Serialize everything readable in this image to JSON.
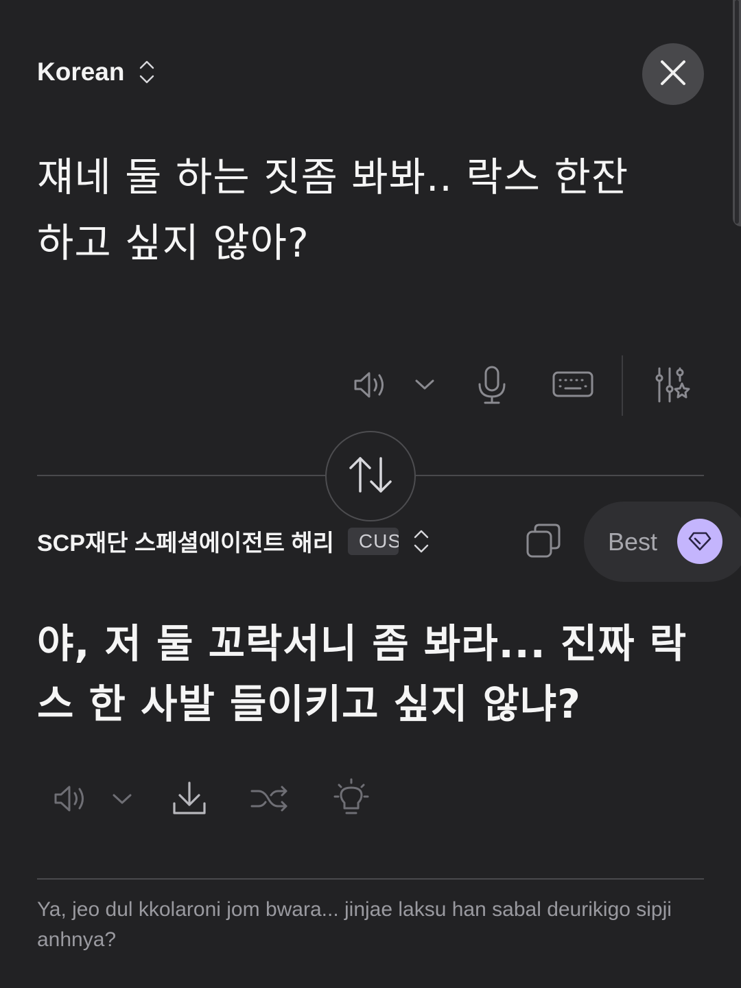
{
  "source": {
    "language": "Korean",
    "text_line1": "쟤네 둘 하는 짓좀 봐봐.. 락스 한잔",
    "text_line2": "하고 싶지 않아?"
  },
  "target": {
    "language": "SCP재단 스페셜에이전트 해리",
    "badge": "CUS",
    "mode_label": "Best",
    "text_line1": "야, 저 둘 꼬락서니 좀 봐라... 진짜 락",
    "text_line2": "스 한 사발 들이키고 싶지 않냐?",
    "romanization": "Ya, jeo dul kkolaroni jom bwara... jinjae laksu han sabal deurikigo sipji anhnya?"
  },
  "icons": {
    "close": "close-icon",
    "listen": "speaker-icon",
    "mic": "microphone-icon",
    "keyboard": "keyboard-icon",
    "settings": "sliders-star-icon",
    "swap": "swap-arrows-icon",
    "copy": "copy-icon",
    "gem": "diamond-icon",
    "download": "download-icon",
    "shuffle": "shuffle-icon",
    "idea": "lightbulb-icon"
  },
  "colors": {
    "background": "#222224",
    "accent": "#c4b5fd",
    "icon": "#8a8a90"
  }
}
